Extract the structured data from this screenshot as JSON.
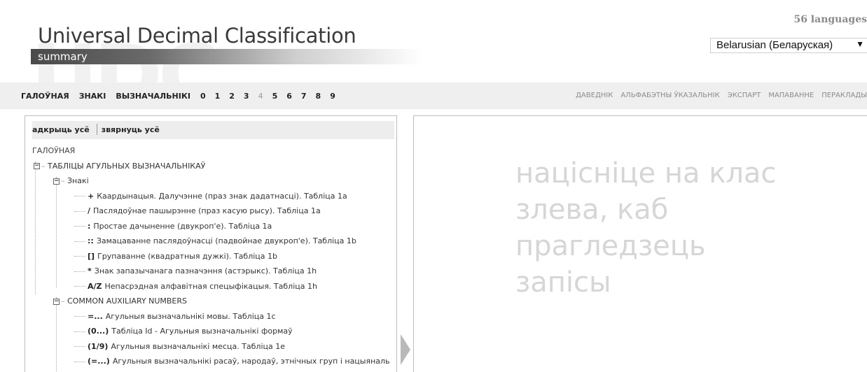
{
  "header": {
    "title": "Universal Decimal Classification",
    "subtitle": "summary",
    "watermark": "UDC",
    "languages_count": "56 languages",
    "language_selected": "Belarusian (Беларуская)",
    "language_arrow": "▼"
  },
  "nav": {
    "left": [
      {
        "label": "ГАЛОЎНАЯ",
        "enabled": true
      },
      {
        "label": "ЗНАКІ",
        "enabled": true
      },
      {
        "label": "ВЫЗНАЧАЛЬНІКІ",
        "enabled": true
      },
      {
        "label": "0",
        "enabled": true
      },
      {
        "label": "1",
        "enabled": true
      },
      {
        "label": "2",
        "enabled": true
      },
      {
        "label": "3",
        "enabled": true
      },
      {
        "label": "4",
        "enabled": false
      },
      {
        "label": "5",
        "enabled": true
      },
      {
        "label": "6",
        "enabled": true
      },
      {
        "label": "7",
        "enabled": true
      },
      {
        "label": "8",
        "enabled": true
      },
      {
        "label": "9",
        "enabled": true
      }
    ],
    "right": [
      "ДАВЕДНІК",
      "АЛЬФАБЭТНЫ ЎКАЗАЛЬНІК",
      "ЭКСПАРТ",
      "МАПАВАННЕ",
      "ПЕРАКЛАДЫ"
    ]
  },
  "tree_toolbar": {
    "expand_all": "адкрыць усё",
    "collapse_all": "звярнуць усё"
  },
  "tree": {
    "root": "ГАЛОЎНАЯ",
    "level1": "ТАБЛІЦЫ АГУЛЬНЫХ ВЫЗНАЧАЛЬНІКАЎ",
    "group1": "Знакі",
    "signs": [
      {
        "sym": "+",
        "text": "Каардынацыя. Далучэнне (праз знак дадатнасці). Табліца 1a"
      },
      {
        "sym": "/",
        "text": "Паслядоўнае пашырэнне (праз касую рысу). Табліца 1a"
      },
      {
        "sym": ":",
        "text": "Простае дачыненне (двукроп'е). Табліца 1a"
      },
      {
        "sym": "::",
        "text": "Замацаванне паслядоўнасці (падвойнае двукроп'е). Табліца 1b"
      },
      {
        "sym": "[]",
        "text": "Групаванне (квадратныя дужкі). Табліца 1b"
      },
      {
        "sym": "*",
        "text": "Знак запазычанага пазначэння (астэрыкс). Табліца 1h"
      },
      {
        "sym": "A/Z",
        "text": "Непасрэдная алфавітная спецыфікацыя. Табліца 1h"
      }
    ],
    "group2": "COMMON AUXILIARY NUMBERS",
    "auxiliaries": [
      {
        "sym": "=...",
        "text": "Агульныя вызначальнікі мовы. Табліца 1c"
      },
      {
        "sym": "(0...)",
        "text": "Табліца Id - Агульныя вызначальнікі формаў"
      },
      {
        "sym": "(1/9)",
        "text": "Агульныя вызначальнікі месца. Табліца 1e"
      },
      {
        "sym": "(=...)",
        "text": "Агульныя вызначальнікі расаў, народаў, этнічных груп і нацыяналь"
      }
    ]
  },
  "content": {
    "hint": "націсніце на клас злева, каб прагледзець запісы"
  }
}
